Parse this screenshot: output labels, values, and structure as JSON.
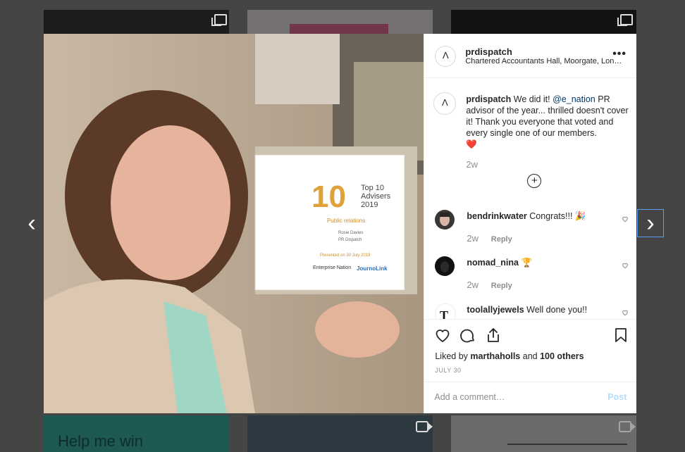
{
  "post": {
    "username": "prdispatch",
    "location": "Chartered Accountants Hall, Moorgate, London",
    "avatar_letter": "Λ",
    "caption_user": "prdispatch",
    "caption_pre": "We did it!",
    "caption_mention": "@e_nation",
    "caption_post": "PR advisor of the year... thrilled doesn't cover it! Thank you everyone that voted and every single one of our members.",
    "caption_emoji": "❤️",
    "caption_time": "2w",
    "more_label": "•••",
    "load_more_label": "+"
  },
  "comments": [
    {
      "user": "bendrinkwater",
      "text": "Congrats!!! 🎉",
      "time": "2w",
      "reply": "Reply"
    },
    {
      "user": "nomad_nina",
      "text": "🏆",
      "time": "2w",
      "reply": "Reply"
    },
    {
      "user": "toolallyjewels",
      "text": "Well done you!!",
      "time": "",
      "reply": ""
    }
  ],
  "engagement": {
    "liked_by_prefix": "Liked by",
    "liked_by_user": "marthaholls",
    "liked_by_and": "and",
    "liked_by_others": "100 others",
    "date": "JULY 30"
  },
  "add_comment": {
    "placeholder": "Add a comment…",
    "post_label": "Post"
  },
  "photo": {
    "certificate_number": "10",
    "certificate_title_1": "Top 10",
    "certificate_title_2": "Advisers",
    "certificate_year": "2019",
    "certificate_category": "Public relations",
    "certificate_name": "Rosie Davies",
    "certificate_company": "PR Dispatch",
    "certificate_presented": "Presented on 30 July 2019",
    "logo_1": "Enterprise Nation",
    "logo_2": "JournoLink"
  },
  "background": {
    "tile_text": "Help me win"
  },
  "nav": {
    "prev": "‹",
    "next": "›"
  },
  "colors": {
    "link": "#00376b",
    "post_disabled": "#b2dffc",
    "overlay": "rgba(0,0,0,0.5)"
  }
}
